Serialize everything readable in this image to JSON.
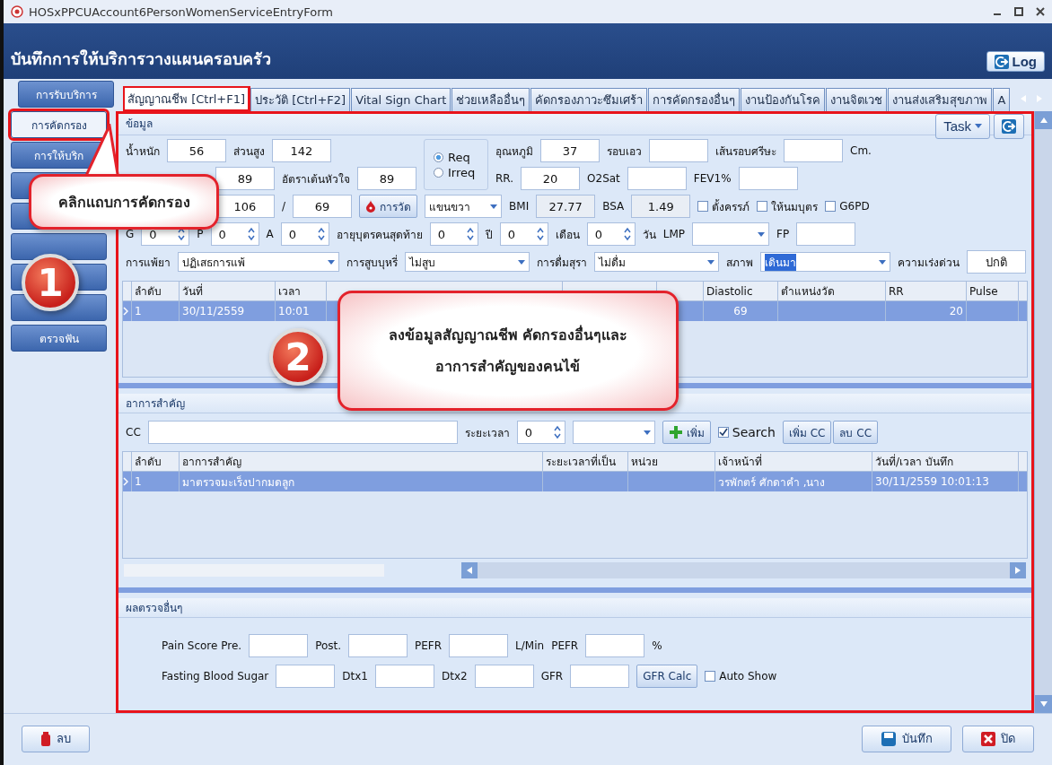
{
  "window": {
    "title": "HOSxPPCUAccount6PersonWomenServiceEntryForm"
  },
  "header": {
    "title": "บันทึกการให้บริการวางแผนครอบครัว",
    "log_button": "Log"
  },
  "sidebar": {
    "items": [
      {
        "label": "การรับบริการ",
        "selected": false,
        "highlighted": false
      },
      {
        "label": "การคัดกรอง",
        "selected": true,
        "highlighted": true
      },
      {
        "label": "การให้บริก",
        "selected": false,
        "highlighted": false
      },
      {
        "selected": false,
        "highlighted": false
      },
      {
        "selected": false,
        "highlighted": false
      },
      {
        "selected": false,
        "highlighted": false
      },
      {
        "selected": false,
        "highlighted": false
      },
      {
        "selected": false,
        "highlighted": false
      },
      {
        "label": "ตรวจฟัน",
        "selected": false,
        "highlighted": false
      }
    ]
  },
  "tabs": [
    {
      "label": "สัญญาณชีพ [Ctrl+F1]",
      "selected": true,
      "highlighted": true
    },
    {
      "label": "ประวัติ [Ctrl+F2]",
      "selected": false,
      "highlighted": false
    },
    {
      "label": "Vital Sign Chart",
      "selected": false,
      "highlighted": false
    },
    {
      "label": "ช่วยเหลืออื่นๆ",
      "selected": false,
      "highlighted": false
    },
    {
      "label": "คัดกรองภาวะซึมเศร้า",
      "selected": false,
      "highlighted": false
    },
    {
      "label": "การคัดกรองอื่นๆ",
      "selected": false,
      "highlighted": false
    },
    {
      "label": "งานป้องกันโรค",
      "selected": false,
      "highlighted": false
    },
    {
      "label": "งานจิตเวช",
      "selected": false,
      "highlighted": false
    },
    {
      "label": "งานส่งเสริมสุขภาพ",
      "selected": false,
      "highlighted": false
    },
    {
      "label": "A",
      "selected": false,
      "highlighted": false
    }
  ],
  "vitals": {
    "section_title": "ข้อมูล",
    "task_button": "Task",
    "highlighted": true,
    "top_left": [
      [
        {
          "kind": "label",
          "text": "น้ำหนัก"
        },
        {
          "kind": "input",
          "value": "56"
        },
        {
          "kind": "label",
          "text": "ส่วนสูง"
        },
        {
          "kind": "input",
          "value": "142"
        }
      ],
      [
        {
          "kind": "blank"
        },
        {
          "kind": "input",
          "value": "89"
        },
        {
          "kind": "label",
          "text": "อัตราเต้นหัวใจ"
        },
        {
          "kind": "input",
          "value": "89"
        }
      ]
    ],
    "rhythm": [
      {
        "label": "Req",
        "selected": true
      },
      {
        "label": "Irreq",
        "selected": false
      }
    ],
    "top_right": [
      [
        {
          "kind": "label",
          "text": "อุณหภูมิ"
        },
        {
          "kind": "input",
          "value": "37"
        },
        {
          "kind": "label",
          "text": "รอบเอว"
        },
        {
          "kind": "input"
        },
        {
          "kind": "label",
          "text": "เส้นรอบศรีษะ"
        },
        {
          "kind": "input"
        },
        {
          "kind": "label",
          "text": "Cm."
        }
      ],
      [
        {
          "kind": "label",
          "text": "RR."
        },
        {
          "kind": "input",
          "value": "20"
        },
        {
          "kind": "label",
          "text": "O2Sat"
        },
        {
          "kind": "input"
        },
        {
          "kind": "label",
          "text": "FEV1%"
        },
        {
          "kind": "input"
        }
      ]
    ],
    "lines": [
      {
        "items": [
          {
            "kind": "blank"
          },
          {
            "kind": "input",
            "value": "106"
          },
          {
            "kind": "label",
            "text": "/"
          },
          {
            "kind": "input",
            "value": "69"
          },
          {
            "kind": "measure",
            "text": "การวัด"
          },
          {
            "kind": "combo",
            "value": "แขนขวา"
          },
          {
            "kind": "label",
            "text": "BMI"
          },
          {
            "kind": "readonly",
            "value": "27.77"
          },
          {
            "kind": "label",
            "text": "BSA"
          },
          {
            "kind": "readonly",
            "value": "1.49"
          },
          {
            "kind": "check",
            "text": "ตั้งครรภ์",
            "checked": false
          },
          {
            "kind": "check",
            "text": "ให้นมบุตร",
            "checked": false
          },
          {
            "kind": "check",
            "text": "G6PD",
            "checked": false
          }
        ]
      },
      {
        "items": [
          {
            "kind": "label",
            "text": "G"
          },
          {
            "kind": "spin",
            "value": "0"
          },
          {
            "kind": "label",
            "text": "P"
          },
          {
            "kind": "spin",
            "value": "0"
          },
          {
            "kind": "label",
            "text": "A"
          },
          {
            "kind": "spin",
            "value": "0"
          },
          {
            "kind": "label",
            "text": "อายุบุตรคนสุดท้าย"
          },
          {
            "kind": "spin",
            "value": "0"
          },
          {
            "kind": "label",
            "text": "ปี"
          },
          {
            "kind": "spin",
            "value": "0"
          },
          {
            "kind": "label",
            "text": "เดือน"
          },
          {
            "kind": "spin",
            "value": "0"
          },
          {
            "kind": "label",
            "text": "วัน"
          },
          {
            "kind": "label",
            "text": "LMP"
          },
          {
            "kind": "combo"
          },
          {
            "kind": "label",
            "text": "FP"
          },
          {
            "kind": "input"
          }
        ]
      },
      {
        "items": [
          {
            "kind": "label",
            "text": "การแพ้ยา"
          },
          {
            "kind": "combo",
            "value": "ปฏิเสธการแพ้"
          },
          {
            "kind": "label",
            "text": "การสูบบุหรี่"
          },
          {
            "kind": "combo",
            "value": "ไม่สูบ"
          },
          {
            "kind": "label",
            "text": "การดื่มสุรา"
          },
          {
            "kind": "combo",
            "value": "ไม่ดื่ม"
          },
          {
            "kind": "label",
            "text": "สภาพ"
          },
          {
            "kind": "combo",
            "value": "เดินมา",
            "highlighted_value": true
          },
          {
            "kind": "label",
            "text": "ความเร่งด่วน"
          },
          {
            "kind": "input",
            "value": "ปกติ"
          }
        ]
      }
    ],
    "table": {
      "columns": [
        "ลำดับ",
        "วันที่",
        "เวลา",
        null,
        null,
        null,
        "Diastolic",
        "ตำแหน่งวัด",
        "RR",
        "Pulse"
      ],
      "rows": [
        {
          "selected": true,
          "cells": [
            "1",
            "30/11/2559",
            "10:01",
            null,
            null,
            null,
            "69",
            null,
            "20",
            null
          ]
        }
      ]
    }
  },
  "complaints": {
    "section_title": "อาการสำคัญ",
    "cc_label": "CC",
    "duration_label": "ระยะเวลา",
    "duration": "0",
    "add_button": "เพิ่ม",
    "search": {
      "label": "Search",
      "checked": true
    },
    "add_cc_button": "เพิ่ม CC",
    "delete_cc_button": "ลบ CC",
    "table": {
      "columns": [
        "ลำดับ",
        "อาการสำคัญ",
        "ระยะเวลาที่เป็น",
        "หน่วย",
        "เจ้าหน้าที่",
        "วันที่/เวลา บันทึก"
      ],
      "rows": [
        {
          "selected": true,
          "cells": [
            "1",
            "มาตรวจมะเร็งปากมดลูก",
            null,
            null,
            "วรพักตร์ ศักดาคำ ,นาง",
            "30/11/2559 10:01:13"
          ]
        }
      ]
    }
  },
  "other_results": {
    "section_title": "ผลตรวจอื่นๆ",
    "lines": [
      {
        "items": [
          {
            "kind": "label",
            "text": "Pain Score Pre."
          },
          {
            "kind": "input"
          },
          {
            "kind": "label",
            "text": "Post."
          },
          {
            "kind": "input"
          },
          {
            "kind": "label",
            "text": "PEFR"
          },
          {
            "kind": "input"
          },
          {
            "kind": "label",
            "text": "L/Min"
          },
          {
            "kind": "label",
            "text": "PEFR"
          },
          {
            "kind": "input"
          },
          {
            "kind": "label",
            "text": "%"
          }
        ]
      },
      {
        "items": [
          {
            "kind": "label",
            "text": "Fasting Blood Sugar"
          },
          {
            "kind": "input"
          },
          {
            "kind": "label",
            "text": "Dtx1"
          },
          {
            "kind": "input"
          },
          {
            "kind": "label",
            "text": "Dtx2"
          },
          {
            "kind": "input"
          },
          {
            "kind": "label",
            "text": "GFR"
          },
          {
            "kind": "input"
          },
          {
            "kind": "calc",
            "text": "GFR Calc"
          },
          {
            "kind": "check",
            "text": "Auto Show",
            "checked": false
          }
        ]
      }
    ]
  },
  "footer": {
    "delete_button": "ลบ",
    "save_button": "บันทึก",
    "close_button": "ปิด"
  },
  "callouts": [
    {
      "text": "คลิกแถบการคัดกรอง",
      "number": "1"
    },
    {
      "lines": [
        "ลงข้อมูลสัญญาณชีพ คัดกรองอื่นๆและ",
        "อาการสำคัญของคนไข้"
      ],
      "number": "2"
    }
  ]
}
